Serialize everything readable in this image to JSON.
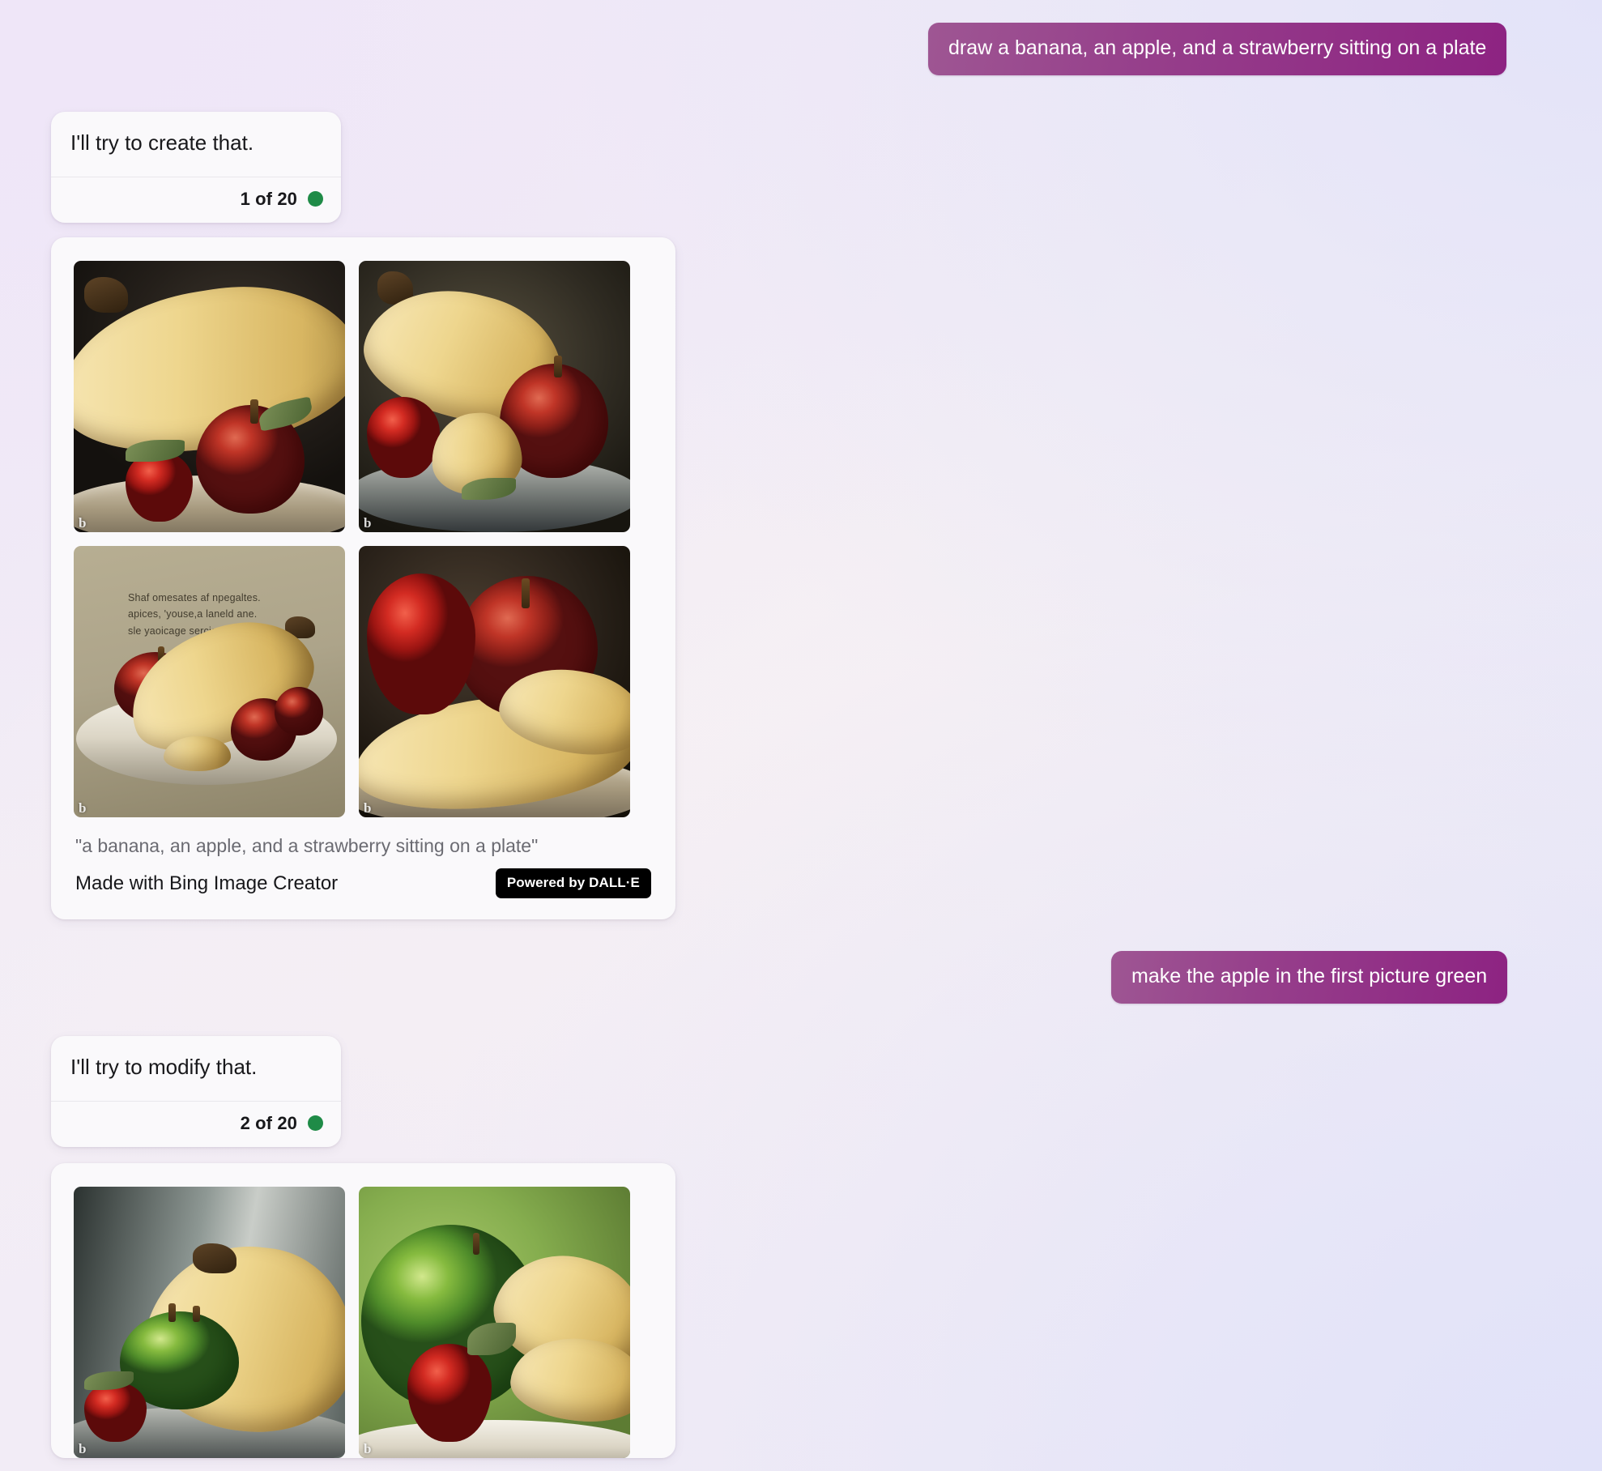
{
  "background": {
    "top_left": "#efe6f8",
    "top_right": "#e3e3f9",
    "bottom_right": "#e1e2f9",
    "center": "#f7f0f3"
  },
  "theme": {
    "user_bubble_from": "#9e5693",
    "user_bubble_to": "#8d2382",
    "card_bg": "#faf9fb",
    "status_green": "#1f8b47",
    "badge_bg": "#000000"
  },
  "conversation": [
    {
      "role": "user",
      "name": "user-message-1",
      "text": "draw a banana, an apple, and a strawberry sitting on a plate"
    },
    {
      "role": "assistant",
      "name": "assistant-message-1",
      "text": "I'll try to create that.",
      "counter": "1 of 20",
      "status": "ready"
    },
    {
      "role": "assistant-images",
      "name": "image-results-1",
      "prompt_caption": "\"a banana, an apple, and a strawberry sitting on a plate\"",
      "made_with": "Made with Bing Image Creator",
      "badge": "Powered by DALL·E",
      "watermark": "b",
      "images": [
        {
          "name": "generated-image-1",
          "alt": "banana with red apple and strawberry on a plate, dark moody background",
          "style": "bg-dark-moody"
        },
        {
          "name": "generated-image-2",
          "alt": "bananas, red apple and strawberry on a dark plate, olive background",
          "style": "bg-dark-olive"
        },
        {
          "name": "generated-image-3",
          "alt": "banana, red apple and plums on a white plate with garbled printed text",
          "style": "bg-khaki",
          "overlay_text": "Shaf omesates af npegaltes.\napices, 'youse,a laneld ane.\nsle yaoicage sercia tpecess."
        },
        {
          "name": "generated-image-4",
          "alt": "close-up of strawberry, red apple and banana",
          "style": "bg-warm-dark"
        }
      ]
    },
    {
      "role": "user",
      "name": "user-message-2",
      "text": "make the apple in the first picture green"
    },
    {
      "role": "assistant",
      "name": "assistant-message-2",
      "text": "I'll try to modify that.",
      "counter": "2 of 20",
      "status": "ready"
    },
    {
      "role": "assistant-images",
      "name": "image-results-2",
      "watermark": "b",
      "images": [
        {
          "name": "generated-image-5",
          "alt": "green apple with banana and strawberry on a plate, cool grey background",
          "style": "bg-cool-grey"
        },
        {
          "name": "generated-image-6",
          "alt": "bright green apple with bananas and strawberry, green bokeh background",
          "style": "bg-green-bokeh"
        }
      ]
    }
  ]
}
